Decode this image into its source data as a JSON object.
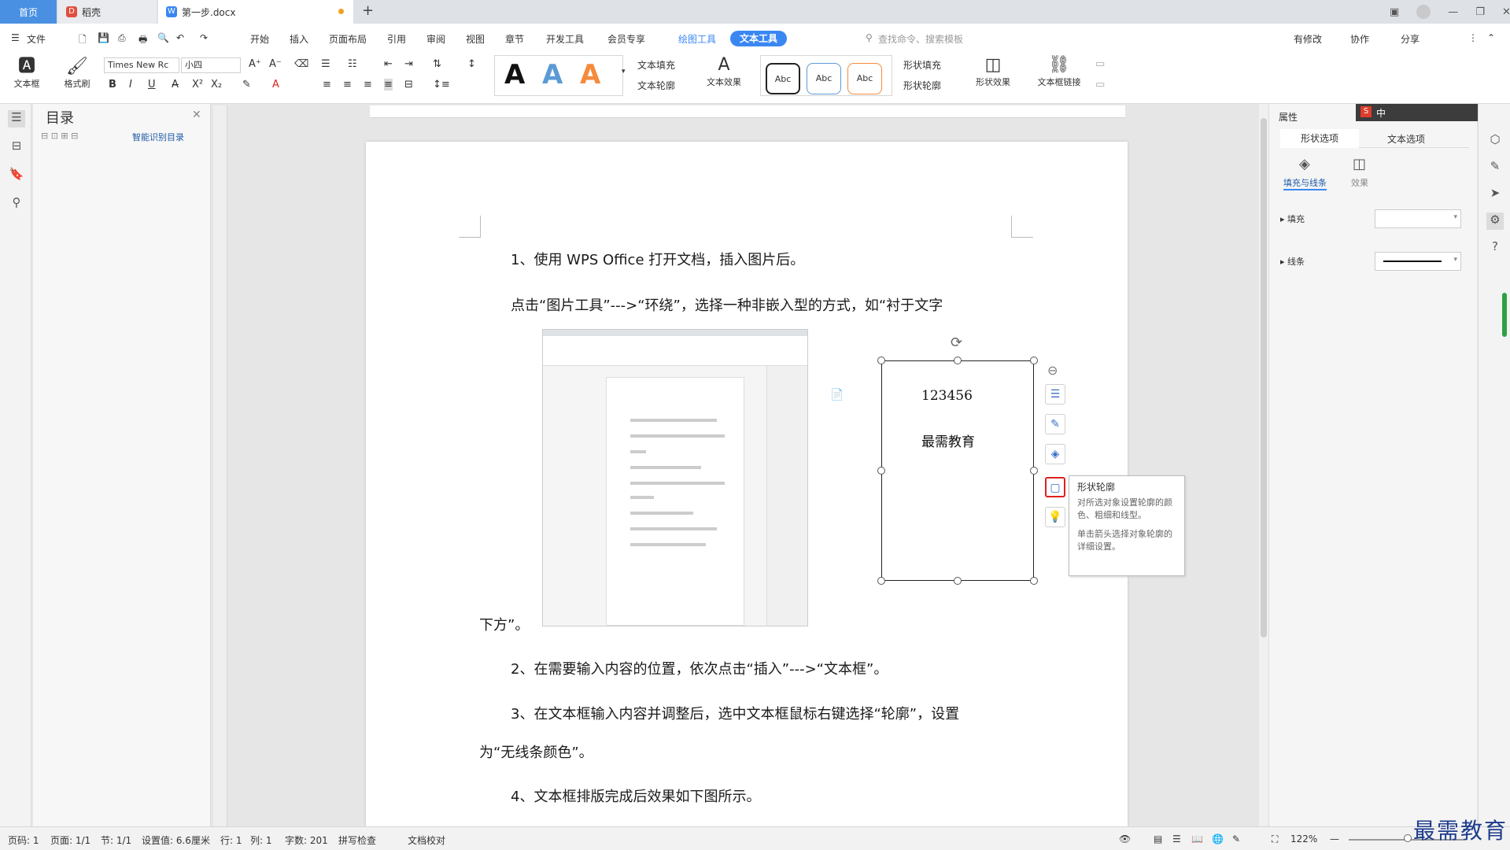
{
  "tabs": {
    "home": "首页",
    "daoke": "稻壳",
    "doc": "第一步.docx",
    "new_tab": "+"
  },
  "menu": {
    "file": "文件",
    "items": [
      "开始",
      "插入",
      "页面布局",
      "引用",
      "审阅",
      "视图",
      "章节",
      "开发工具",
      "会员专享"
    ],
    "drawing_tools": "绘图工具",
    "text_tools": "文本工具",
    "search_placeholder": "查找命令、搜索模板",
    "changes": "有修改",
    "collab": "协作",
    "share": "分享"
  },
  "ribbon": {
    "textbox": "文本框",
    "format_painter": "格式刷",
    "font_name": "Times New Rc",
    "font_size": "小四",
    "text_fill": "文本填充",
    "text_outline": "文本轮廓",
    "text_effect": "文本效果",
    "styles": [
      "A",
      "A",
      "A"
    ],
    "abc": [
      "Abc",
      "Abc",
      "Abc"
    ],
    "shape_fill": "形状填充",
    "shape_outline": "形状轮廓",
    "shape_effect": "形状效果",
    "textbox_link": "文本框链接",
    "bold": "B",
    "italic": "I",
    "underline": "U"
  },
  "toc": {
    "title": "目录",
    "smart": "智能识别目录"
  },
  "document": {
    "p1": "1、使用 WPS Office 打开文档，插入图片后。",
    "p2": "点击“图片工具”--->“环绕”，选择一种非嵌入型的方式，如“衬于文字",
    "p2b": "下方”。",
    "p3": "2、在需要输入内容的位置，依次点击“插入”--->“文本框”。",
    "p4": "3、在文本框输入内容并调整后，选中文本框鼠标右键选择“轮廓”，设置",
    "p4b": "为“无线条颜色”。",
    "p5": "4、文本框排版完成后效果如下图所示。",
    "textbox_line1": "123456",
    "textbox_line2": "最需教育"
  },
  "tooltip": {
    "title": "形状轮廓",
    "line1": "对所选对象设置轮廓的颜色、粗细和线型。",
    "line2": "单击箭头选择对象轮廓的详细设置。"
  },
  "panel": {
    "properties": "属性",
    "tab_shape": "形状选项",
    "tab_text": "文本选项",
    "fill_line": "填充与线条",
    "effects": "效果",
    "fill": "填充",
    "line": "线条"
  },
  "ime": {
    "lang": "中"
  },
  "status": {
    "page_no": "页码: 1",
    "pages": "页面: 1/1",
    "section": "节: 1/1",
    "setting": "设置值: 6.6厘米",
    "row": "行: 1",
    "col": "列: 1",
    "words": "字数: 201",
    "spell": "拼写检查",
    "proof": "文档校对",
    "zoom": "122%"
  },
  "watermark": "最需教育",
  "colors": {
    "accent": "#3a87f2",
    "highlight_box": "#e02020"
  }
}
